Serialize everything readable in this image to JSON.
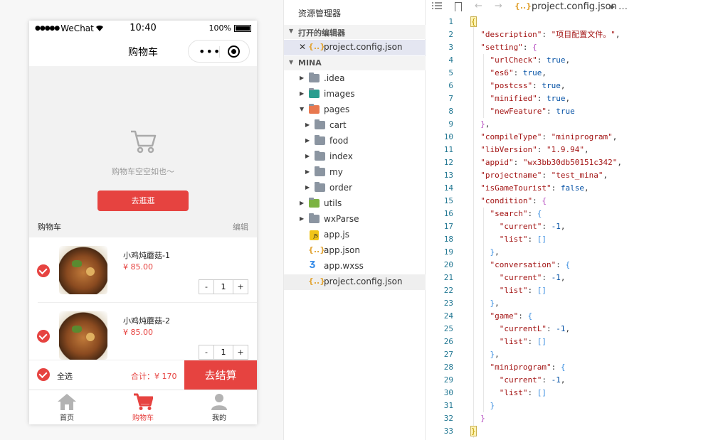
{
  "simulator": {
    "status": {
      "carrier": "WeChat",
      "time": "10:40",
      "battery": "100%",
      "battery_level": 1.0
    },
    "nav_title": "购物车",
    "empty": {
      "text": "购物车空空如也～",
      "button": "去逛逛"
    },
    "cart_header": {
      "title": "购物车",
      "edit": "编辑"
    },
    "items": [
      {
        "name": "小鸡炖蘑菇-1",
        "price": "¥ 85.00",
        "qty": "1",
        "minus": "-",
        "plus": "+"
      },
      {
        "name": "小鸡炖蘑菇-2",
        "price": "¥ 85.00",
        "qty": "1",
        "minus": "-",
        "plus": "+"
      }
    ],
    "checkout": {
      "select_all": "全选",
      "total": "合计：¥ 170",
      "button": "去结算"
    },
    "tabs": [
      {
        "label": "首页",
        "icon": "home-icon"
      },
      {
        "label": "购物车",
        "icon": "cart-icon",
        "active": true
      },
      {
        "label": "我的",
        "icon": "user-icon"
      }
    ],
    "accent_color": "#e64340"
  },
  "explorer": {
    "title": "资源管理器",
    "open_editors_label": "打开的编辑器",
    "open_editor_file": "project.config.json",
    "project_label": "MINA",
    "tree": [
      {
        "name": ".idea",
        "type": "folder"
      },
      {
        "name": "images",
        "type": "folder-images"
      },
      {
        "name": "pages",
        "type": "folder-pages",
        "expanded": true
      },
      {
        "name": "cart",
        "type": "folder"
      },
      {
        "name": "food",
        "type": "folder"
      },
      {
        "name": "index",
        "type": "folder"
      },
      {
        "name": "my",
        "type": "folder"
      },
      {
        "name": "order",
        "type": "folder"
      },
      {
        "name": "utils",
        "type": "folder-utils"
      },
      {
        "name": "wxParse",
        "type": "folder"
      },
      {
        "name": "app.js",
        "type": "js"
      },
      {
        "name": "app.json",
        "type": "json"
      },
      {
        "name": "app.wxss",
        "type": "css"
      },
      {
        "name": "project.config.json",
        "type": "json"
      }
    ]
  },
  "editor": {
    "breadcrumb_file": "project.config.json",
    "breadcrumb_more": "…",
    "lines": [
      "{",
      "  \"description\": \"项目配置文件。\",",
      "  \"setting\": {",
      "    \"urlCheck\": true,",
      "    \"es6\": true,",
      "    \"postcss\": true,",
      "    \"minified\": true,",
      "    \"newFeature\": true",
      "  },",
      "  \"compileType\": \"miniprogram\",",
      "  \"libVersion\": \"1.9.94\",",
      "  \"appid\": \"wx3bb30db50151c342\",",
      "  \"projectname\": \"test_mina\",",
      "  \"isGameTourist\": false,",
      "  \"condition\": {",
      "    \"search\": {",
      "      \"current\": -1,",
      "      \"list\": []",
      "    },",
      "    \"conversation\": {",
      "      \"current\": -1,",
      "      \"list\": []",
      "    },",
      "    \"game\": {",
      "      \"currentL\": -1,",
      "      \"list\": []",
      "    },",
      "    \"miniprogram\": {",
      "      \"current\": -1,",
      "      \"list\": []",
      "    }",
      "  }",
      "}"
    ]
  }
}
